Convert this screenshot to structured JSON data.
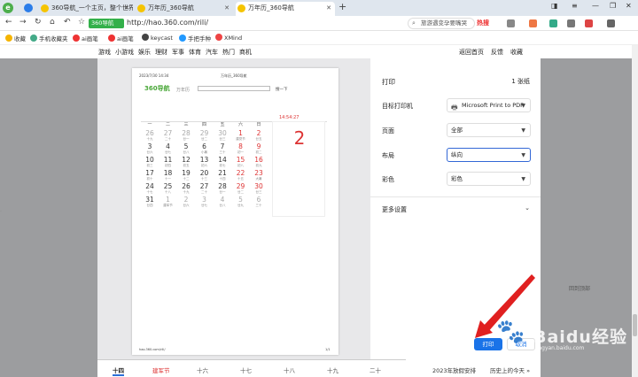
{
  "tabs": [
    {
      "title": "360导航_一个主页，整个世界",
      "active": false
    },
    {
      "title": "万年历_360导航",
      "active": false
    },
    {
      "title": "万年历_360导航",
      "active": true
    }
  ],
  "toolbar": {
    "site_badge": "360导航",
    "url": "http://hao.360.com/rili/",
    "search_placeholder": "旅游遇变孕要嘴哭",
    "hot_label": "热搜"
  },
  "bookmarks": [
    "收藏",
    "手机收藏夹",
    "ai画笔",
    "ai画笔",
    "keycast",
    "手把手种",
    "XMind"
  ],
  "site_nav": [
    "游戏",
    "小游戏",
    "娱乐",
    "理财",
    "军事",
    "体育",
    "汽车",
    "热门",
    "商机"
  ],
  "site_toplinks": [
    "返回首页",
    "反馈",
    "收藏"
  ],
  "preview": {
    "header_left": "2023/7/30 14:34",
    "header_center": "万年历_360导航",
    "logo": "360导航",
    "logo_sub": "万年历",
    "search_btn": "搜一下",
    "weekdays": [
      "一",
      "二",
      "三",
      "四",
      "五",
      "六",
      "日"
    ],
    "rows": [
      [
        [
          "26",
          "十九"
        ],
        [
          "27",
          "二十"
        ],
        [
          "28",
          "廿一"
        ],
        [
          "29",
          "廿二"
        ],
        [
          "30",
          "廿三"
        ],
        [
          "1",
          "建党节"
        ],
        [
          "2",
          "廿五"
        ]
      ],
      [
        [
          "3",
          "廿六"
        ],
        [
          "4",
          "廿七"
        ],
        [
          "5",
          "廿八"
        ],
        [
          "6",
          "小暑"
        ],
        [
          "7",
          "三十"
        ],
        [
          "8",
          "初一"
        ],
        [
          "9",
          "初二"
        ]
      ],
      [
        [
          "10",
          "初三"
        ],
        [
          "11",
          "初四"
        ],
        [
          "12",
          "初五"
        ],
        [
          "13",
          "初六"
        ],
        [
          "14",
          "初七"
        ],
        [
          "15",
          "初八"
        ],
        [
          "16",
          "初九"
        ]
      ],
      [
        [
          "17",
          "初十"
        ],
        [
          "18",
          "十一"
        ],
        [
          "19",
          "十二"
        ],
        [
          "20",
          "十三"
        ],
        [
          "21",
          "十四"
        ],
        [
          "22",
          "十五"
        ],
        [
          "23",
          "大暑"
        ]
      ],
      [
        [
          "24",
          "十七"
        ],
        [
          "25",
          "十八"
        ],
        [
          "26",
          "十九"
        ],
        [
          "27",
          "二十"
        ],
        [
          "28",
          "廿一"
        ],
        [
          "29",
          "廿二"
        ],
        [
          "30",
          "廿三"
        ]
      ],
      [
        [
          "31",
          "廿四"
        ],
        [
          "1",
          "建军节"
        ],
        [
          "2",
          "廿六"
        ],
        [
          "3",
          "廿七"
        ],
        [
          "4",
          "廿八"
        ],
        [
          "5",
          "廿九"
        ],
        [
          "6",
          "三十"
        ]
      ]
    ],
    "big_day": "2",
    "time": "14:54:27",
    "footer_left": "hao.360.com/rili/",
    "page_no": "1/1"
  },
  "print": {
    "title": "打印",
    "sheets": "1 张纸",
    "fields": [
      {
        "label": "目标打印机",
        "value": "Microsoft Print to PDF"
      },
      {
        "label": "页面",
        "value": "全部"
      },
      {
        "label": "布局",
        "value": "纵向"
      },
      {
        "label": "彩色",
        "value": "彩色"
      }
    ],
    "more_settings": "更多设置",
    "print_btn": "打印",
    "cancel_btn": "取消"
  },
  "return_top": "回到顶部",
  "bottom_tabs": [
    "十四",
    "建军节",
    "十六",
    "十七",
    "十八",
    "十九",
    "二十"
  ],
  "bottom_right": [
    "2023年放假安排",
    "历史上的今天 »"
  ],
  "watermark": {
    "text": "Baidu经验",
    "url": "jingyan.baidu.com"
  },
  "colors": {
    "accent": "#1a73e8",
    "red": "#d33333",
    "green": "#4ba83a"
  }
}
